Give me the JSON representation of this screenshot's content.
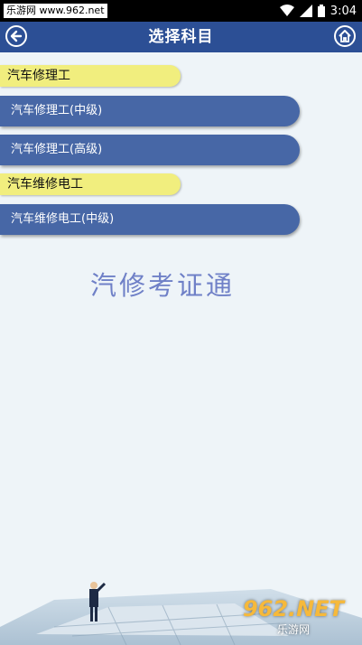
{
  "status_bar": {
    "watermark_text": "乐游网 www.962.net",
    "time": "3:04"
  },
  "app_bar": {
    "title": "选择科目",
    "back_icon": "back-arrow-icon",
    "home_icon": "home-icon"
  },
  "sections": [
    {
      "header": "汽车修理工",
      "items": [
        "汽车修理工(中级)",
        "汽车修理工(高级)"
      ]
    },
    {
      "header": "汽车维修电工",
      "items": [
        "汽车维修电工(中级)"
      ]
    }
  ],
  "brand_text": "汽修考证通",
  "bottom_watermark": {
    "big": "962.NET",
    "small": "乐游网"
  },
  "colors": {
    "app_bar": "#2c4f95",
    "button": "#4767a6",
    "tab": "#f1ee7e",
    "brand": "#6f80c7"
  }
}
